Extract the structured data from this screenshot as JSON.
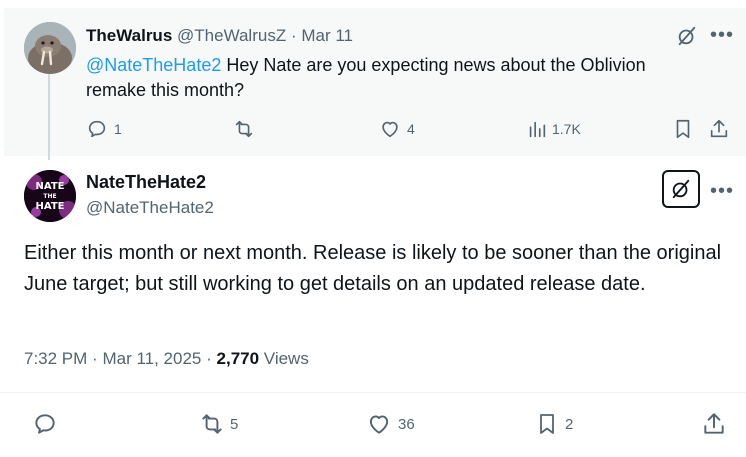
{
  "parent": {
    "author_name": "TheWalrus",
    "handle": "@TheWalrusZ",
    "separator": "·",
    "date": "Mar 11",
    "mention": "@NateTheHate2",
    "text": " Hey Nate are you expecting news about the Oblivion remake this month?",
    "actions": {
      "replies": "1",
      "likes": "4",
      "views": "1.7K"
    }
  },
  "main": {
    "author_name": "NateTheHate2",
    "handle": "@NateTheHate2",
    "avatar_text_line1": "NATE",
    "avatar_text_line2": "THE",
    "avatar_text_line3": "HATE",
    "text": "Either this month or next month. Release is likely to be sooner than the original June target; but still working to get details on an updated release date.",
    "time": "7:32 PM",
    "date": "Mar 11, 2025",
    "separator": "·",
    "views_count": "2,770",
    "views_label": "Views",
    "actions": {
      "reposts": "5",
      "likes": "36",
      "bookmarks": "2"
    }
  },
  "colors": {
    "accent": "#1d9bf0",
    "muted": "#536471",
    "text": "#0f1419",
    "parent_bg": "#f7f9f9"
  }
}
